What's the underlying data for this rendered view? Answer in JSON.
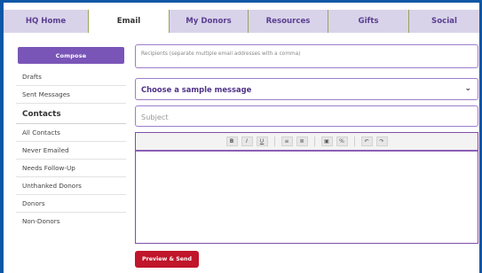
{
  "tabs": [
    {
      "label": "HQ Home"
    },
    {
      "label": "Email"
    },
    {
      "label": "My Donors"
    },
    {
      "label": "Resources"
    },
    {
      "label": "Gifts"
    },
    {
      "label": "Social"
    }
  ],
  "sidebar": {
    "compose_label": "Compose",
    "items": [
      {
        "label": "Drafts"
      },
      {
        "label": "Sent Messages"
      }
    ],
    "contacts_heading": "Contacts",
    "contacts": [
      {
        "label": "All Contacts"
      },
      {
        "label": "Never Emailed"
      },
      {
        "label": "Needs Follow-Up"
      },
      {
        "label": "Unthanked Donors"
      },
      {
        "label": "Donors"
      },
      {
        "label": "Non-Donors"
      }
    ]
  },
  "form": {
    "recipients_placeholder": "Recipients (separate multiple email addresses with a comma)",
    "sample_select": "Choose a sample message",
    "subject_placeholder": "Subject",
    "toolbar": [
      "B",
      "I",
      "U",
      "≡",
      "≣",
      "▣",
      "%",
      "↶",
      "↷"
    ],
    "preview_label": "Preview & Send"
  },
  "colors": {
    "background": "#0c57a6",
    "tab_bar": "#d9d3ea",
    "accent": "#7a55b8",
    "preview_button": "#c0152a"
  }
}
